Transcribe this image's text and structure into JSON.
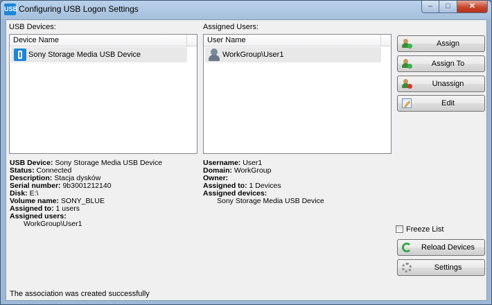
{
  "window": {
    "title": "Configuring USB Logon Settings",
    "icon": "usb-app-icon",
    "controls": {
      "minimize": "–",
      "maximize": "□",
      "close": "✕"
    }
  },
  "devices": {
    "label": "USB Devices:",
    "column": "Device Name",
    "items": [
      {
        "name": "Sony Storage Media USB Device",
        "icon": "usb-drive-icon"
      }
    ]
  },
  "users": {
    "label": "Assigned Users:",
    "column": "User Name",
    "items": [
      {
        "name": "WorkGroup\\User1",
        "icon": "user-icon"
      }
    ]
  },
  "device_info": {
    "usb_device": {
      "label": "USB Device:",
      "value": "Sony Storage Media USB Device"
    },
    "status": {
      "label": "Status:",
      "value": "Connected"
    },
    "description": {
      "label": "Description:",
      "value": "Stacja dysków"
    },
    "serial": {
      "label": "Serial number:",
      "value": "9b3001212140"
    },
    "disk": {
      "label": "Disk:",
      "value": "E:\\"
    },
    "volume": {
      "label": "Volume name:",
      "value": "SONY_BLUE"
    },
    "assigned_to": {
      "label": "Assigned to:",
      "value": "1 users"
    },
    "assigned_users": {
      "label": "Assigned users:",
      "items": [
        "WorkGroup\\User1"
      ]
    }
  },
  "user_info": {
    "username": {
      "label": "Username:",
      "value": "User1"
    },
    "domain": {
      "label": "Domain:",
      "value": "WorkGroup"
    },
    "owner": {
      "label": "Owner:",
      "value": ""
    },
    "assigned_to": {
      "label": "Assigned to:",
      "value": "1 Devices"
    },
    "assigned_devices": {
      "label": "Assigned devices:",
      "items": [
        "Sony Storage Media USB Device"
      ]
    }
  },
  "actions": {
    "assign": "Assign",
    "assign_to": "Assign To",
    "unassign": "Unassign",
    "edit": "Edit",
    "freeze_list": "Freeze List",
    "reload": "Reload Devices",
    "settings": "Settings"
  },
  "status_message": "The association was created successfully"
}
